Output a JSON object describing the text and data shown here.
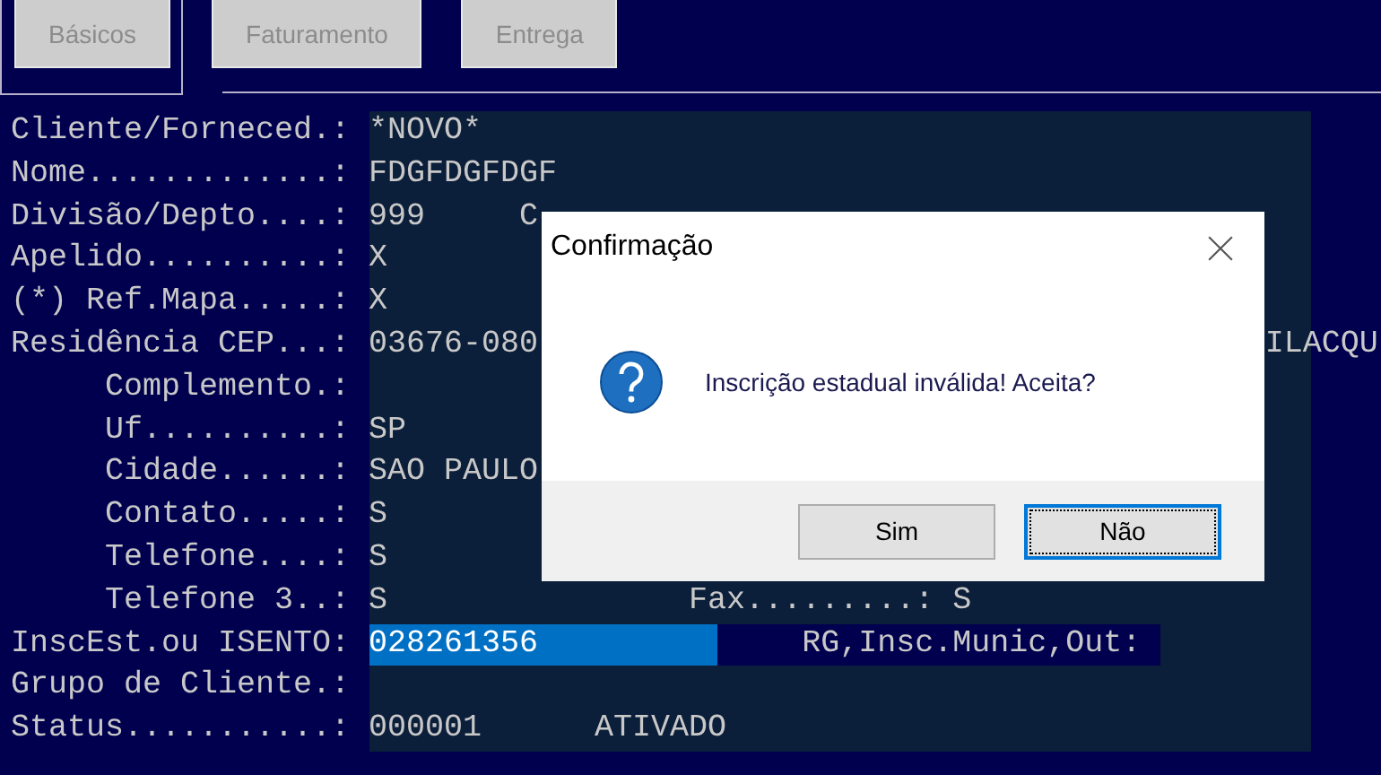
{
  "tabs": [
    {
      "label": "Básicos",
      "selected": true
    },
    {
      "label": "Faturamento",
      "selected": false
    },
    {
      "label": "Entrega",
      "selected": false
    }
  ],
  "form": {
    "rows": [
      {
        "label": "Cliente/Forneced.:",
        "value": "*NOVO*",
        "selected": false,
        "extras": []
      },
      {
        "label": "Nome.............:",
        "value": "FDGFDGFDGF",
        "selected": false,
        "extras": []
      },
      {
        "label": "Divisão/Depto....:",
        "value": "999",
        "selected": false,
        "extras": [
          "C"
        ]
      },
      {
        "label": "Apelido..........:",
        "value": "X",
        "selected": false,
        "extras": []
      },
      {
        "label": "(*) Ref.Mapa.....:",
        "value": "X",
        "selected": false,
        "extras": []
      },
      {
        "label": "Residência CEP...:",
        "value": "03676-080",
        "selected": false,
        "extras": [
          "ILACQU"
        ]
      },
      {
        "label": "     Complemento.:",
        "value": "",
        "selected": false,
        "extras": []
      },
      {
        "label": "     Uf..........:",
        "value": "SP",
        "selected": false,
        "extras": []
      },
      {
        "label": "     Cidade......:",
        "value": "SAO PAULO",
        "selected": false,
        "extras": []
      },
      {
        "label": "     Contato.....:",
        "value": "S",
        "selected": false,
        "extras": []
      },
      {
        "label": "     Telefone....:",
        "value": "S",
        "selected": false,
        "extras": []
      },
      {
        "label": "     Telefone 3..:",
        "value": "S",
        "selected": false,
        "extras": [
          "Fax.........: S"
        ]
      },
      {
        "label": "InscEst.ou ISENTO:",
        "value": "028261356",
        "selected": true,
        "extras": [
          "RG,Insc.Munic,Out:"
        ]
      },
      {
        "label": "Grupo de Cliente.:",
        "value": "",
        "selected": false,
        "extras": []
      },
      {
        "label": "Status...........:",
        "value": "000001",
        "selected": false,
        "extras": [
          "ATIVADO"
        ]
      }
    ]
  },
  "dialog": {
    "title": "Confirmação",
    "message": "Inscrição estadual inválida! Aceita?",
    "buttons": [
      {
        "label": "Sim",
        "focused": false
      },
      {
        "label": "Não",
        "focused": true
      }
    ]
  }
}
